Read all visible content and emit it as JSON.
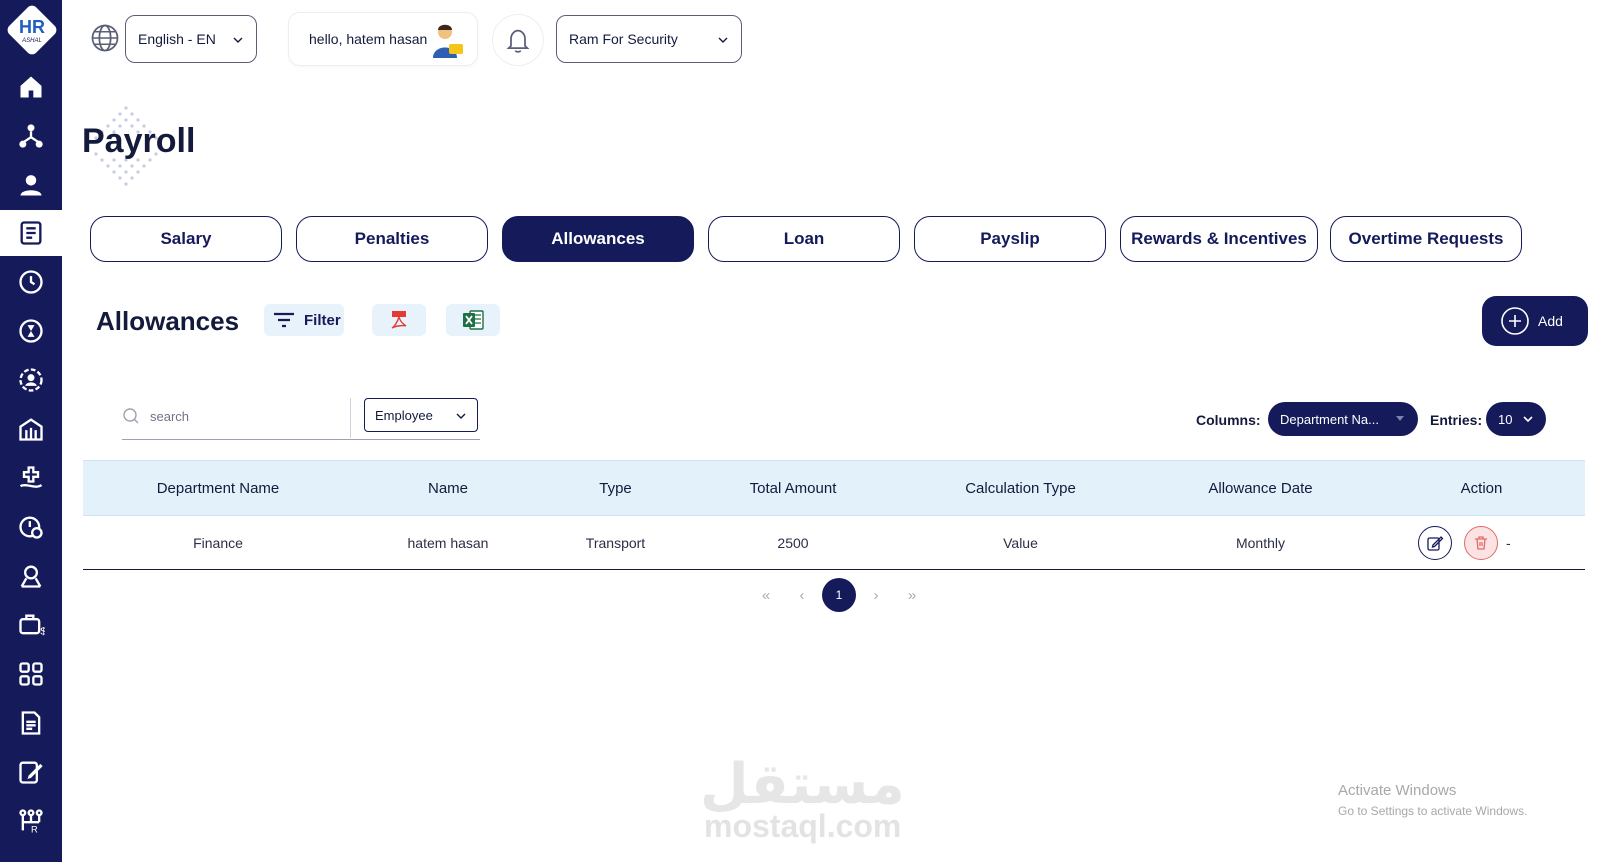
{
  "brand": {
    "logo_text": "HR",
    "logo_subtext": "ASHAL",
    "accent": "#141a5a",
    "accent_light": "#e3f1fb",
    "danger": "#e06a6a"
  },
  "sidebar": {
    "items": [
      {
        "icon": "home-icon"
      },
      {
        "icon": "org-chart-icon"
      },
      {
        "icon": "user-icon"
      },
      {
        "icon": "payroll-icon",
        "active": true
      },
      {
        "icon": "clock-icon"
      },
      {
        "icon": "hourglass-icon"
      },
      {
        "icon": "user-settings-icon"
      },
      {
        "icon": "building-icon"
      },
      {
        "icon": "medical-icon"
      },
      {
        "icon": "time-alert-icon"
      },
      {
        "icon": "recruitment-icon"
      },
      {
        "icon": "briefcase-money-icon"
      },
      {
        "icon": "apps-grid-icon"
      },
      {
        "icon": "report-icon"
      },
      {
        "icon": "task-edit-icon"
      },
      {
        "icon": "hr-settings-icon"
      }
    ]
  },
  "topbar": {
    "language": "English - EN",
    "greeting": "hello, hatem hasan",
    "company": "Ram For Security"
  },
  "page": {
    "title": "Payroll"
  },
  "tabs": [
    {
      "label": "Salary"
    },
    {
      "label": "Penalties"
    },
    {
      "label": "Allowances",
      "active": true
    },
    {
      "label": "Loan"
    },
    {
      "label": "Payslip"
    },
    {
      "label": "Rewards & Incentives"
    },
    {
      "label": "Overtime Requests"
    }
  ],
  "section": {
    "title": "Allowances",
    "filter_label": "Filter",
    "add_label": "Add"
  },
  "controls": {
    "search_placeholder": "search",
    "search_by": "Employee",
    "columns_label": "Columns:",
    "columns_value": "Department Na...",
    "entries_label": "Entries:",
    "entries_value": "10"
  },
  "table": {
    "headers": [
      "Department Name",
      "Name",
      "Type",
      "Total Amount",
      "Calculation Type",
      "Allowance Date",
      "Action"
    ],
    "rows": [
      {
        "department": "Finance",
        "name": "hatem hasan",
        "type": "Transport",
        "total": "2500",
        "calc_type": "Value",
        "date": "Monthly",
        "extra": "-"
      }
    ]
  },
  "pagination": {
    "current": "1",
    "first": "«",
    "prev": "‹",
    "next": "›",
    "last": "»"
  },
  "watermark": {
    "arabic": "مستقل",
    "latin": "mostaql.com"
  },
  "windows_notice": {
    "line1": "Activate Windows",
    "line2": "Go to Settings to activate Windows."
  }
}
